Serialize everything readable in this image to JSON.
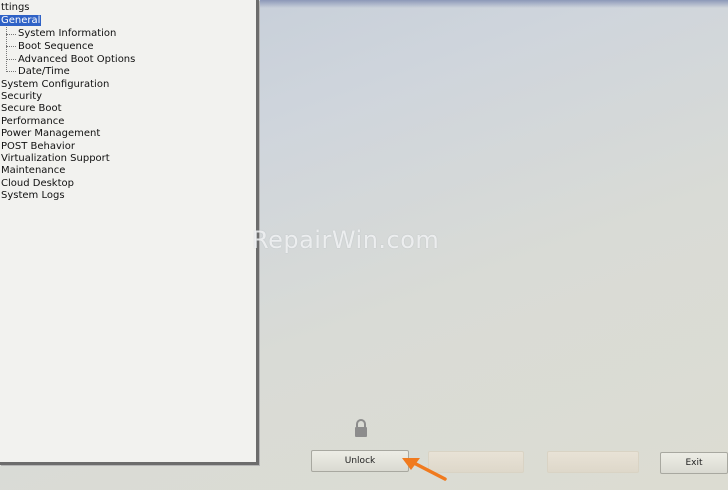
{
  "tree": {
    "root_label": "ttings",
    "items": [
      {
        "label": "General",
        "selected": true
      },
      {
        "label": "System Information"
      },
      {
        "label": "Boot Sequence"
      },
      {
        "label": "Advanced Boot Options"
      },
      {
        "label": "Date/Time"
      },
      {
        "label": "System Configuration"
      },
      {
        "label": "Security"
      },
      {
        "label": "Secure Boot"
      },
      {
        "label": "Performance"
      },
      {
        "label": "Power Management"
      },
      {
        "label": "POST Behavior"
      },
      {
        "label": "Virtualization Support"
      },
      {
        "label": "Maintenance"
      },
      {
        "label": "Cloud Desktop"
      },
      {
        "label": "System Logs"
      }
    ]
  },
  "watermark": "RepairWin.com",
  "buttons": {
    "unlock": "Unlock",
    "exit": "Exit"
  },
  "icons": {
    "lock": "lock-icon",
    "arrow": "arrow-pointer-icon"
  },
  "colors": {
    "selection": "#2f62c6",
    "arrow": "#f07a1e"
  }
}
